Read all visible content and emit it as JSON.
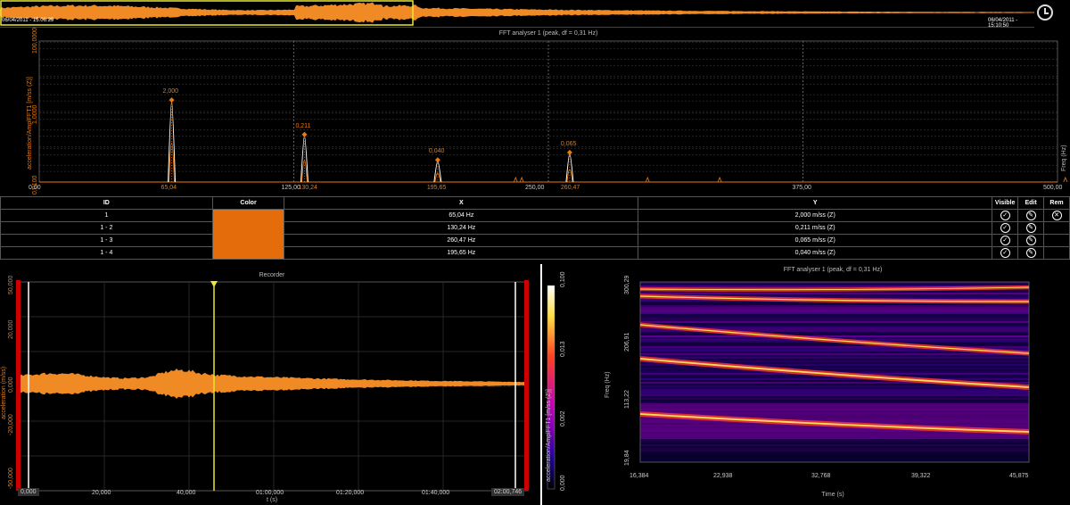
{
  "overview": {
    "start_time": "06/04/2011 - 15:06:29",
    "end_time": "06/04/2011 - 15:10:50"
  },
  "fft": {
    "title": "FFT analyser 1 (peak, df = 0,31 Hz)",
    "ylabel": "acceleration/AmplFFT1 [m/ss (Z)]",
    "xlabel_right": "Freq (Hz)",
    "x_ticks": [
      "0,00",
      "65,04",
      "125,00",
      "130,24",
      "195,65",
      "250,00",
      "260,47",
      "375,00",
      "500,00"
    ],
    "y_ticks": [
      "0,0100",
      "1,0000",
      "100,0000"
    ],
    "peak_labels": [
      "2,000",
      "0,211",
      "0,040",
      "0,065"
    ]
  },
  "table": {
    "headers": [
      "ID",
      "Color",
      "X",
      "Y",
      "Visible",
      "Edit",
      "Rem"
    ],
    "rows": [
      {
        "id": "1",
        "x": "65,04 Hz",
        "y": "2,000 m/ss (Z)"
      },
      {
        "id": "1 - 2",
        "x": "130,24 Hz",
        "y": "0,211 m/ss (Z)"
      },
      {
        "id": "1 - 3",
        "x": "260,47 Hz",
        "y": "0,065 m/ss (Z)"
      },
      {
        "id": "1 - 4",
        "x": "195,65 Hz",
        "y": "0,040 m/ss (Z)"
      }
    ],
    "swatch_color": "#e46c0a",
    "visible_icon": "check-circle-icon",
    "edit_icon": "pencil-circle-icon",
    "rem_icon": "close-circle-icon"
  },
  "recorder": {
    "title": "Recorder",
    "ylabel": "acceleration (m/ss)",
    "xlabel": "t (s)",
    "y_ticks": [
      "50,000",
      "20,000",
      "0,000",
      "-20,000",
      "-50,000"
    ],
    "x_ticks": [
      "0,000",
      "20,000",
      "40,000",
      "01:00,000",
      "01:20,000",
      "01:40,000",
      "02:00,746"
    ]
  },
  "spectrogram": {
    "title": "FFT analyser 1 (peak, df = 0,31 Hz)",
    "colorbar_label": "acceleration/AmplFFT1 [m/ss (Z)]",
    "colorbar_ticks": [
      "0,100",
      "0,013",
      "0,002",
      "0,000"
    ],
    "ylabel": "Freq (Hz)",
    "y_ticks": [
      "300,29",
      "206,91",
      "113,22",
      "19,84"
    ],
    "xlabel": "Time (s)",
    "x_ticks": [
      "16,384",
      "22,938",
      "32,768",
      "39,322",
      "45,875"
    ]
  },
  "chart_data": [
    {
      "type": "line",
      "title": "FFT analyser 1 (peak, df = 0,31 Hz)",
      "xlabel": "Freq (Hz)",
      "ylabel": "acceleration/AmplFFT1 [m/ss (Z)]",
      "xlim": [
        0,
        500
      ],
      "y_scale": "log",
      "peaks": [
        {
          "x": 65.04,
          "y": 2.0
        },
        {
          "x": 130.24,
          "y": 0.211
        },
        {
          "x": 195.65,
          "y": 0.04
        },
        {
          "x": 260.47,
          "y": 0.065
        }
      ]
    }
  ]
}
